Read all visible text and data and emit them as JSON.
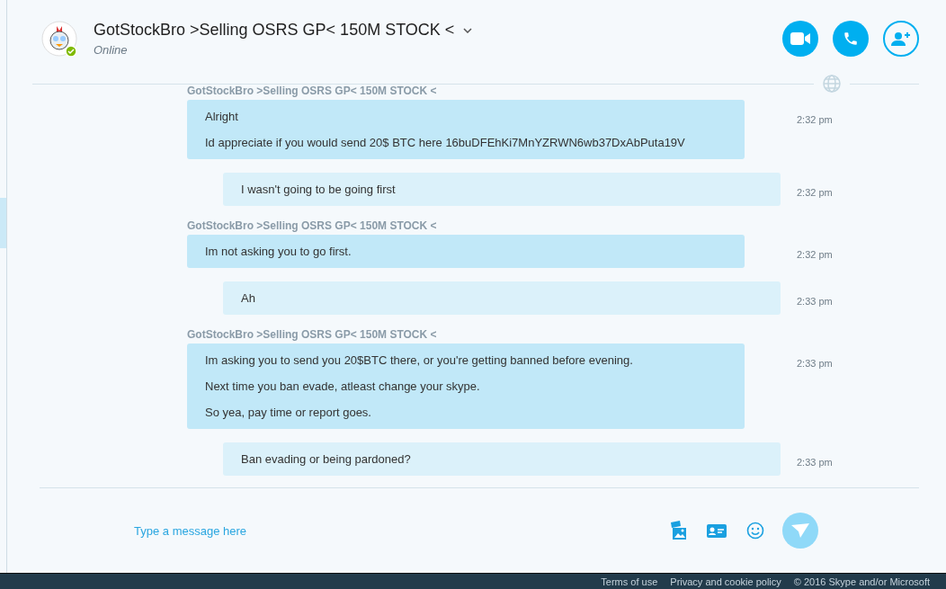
{
  "header": {
    "name": "GotStockBro >Selling OSRS GP< 150M STOCK <",
    "status": "Online",
    "online": true
  },
  "messages": [
    {
      "kind": "incoming",
      "sender": "GotStockBro >Selling OSRS GP< 150M STOCK <",
      "lines": [
        "Alright",
        "Id appreciate if you would send 20$ BTC here 16buDFEhKi7MnYZRWN6wb37DxAbPuta19V"
      ],
      "time": "2:32 pm"
    },
    {
      "kind": "outgoing",
      "lines": [
        "I wasn't going to be going first"
      ],
      "time": "2:32 pm"
    },
    {
      "kind": "incoming",
      "sender": "GotStockBro >Selling OSRS GP< 150M STOCK <",
      "lines": [
        "Im not asking you to go first."
      ],
      "time": "2:32 pm"
    },
    {
      "kind": "outgoing",
      "lines": [
        "Ah"
      ],
      "time": "2:33 pm"
    },
    {
      "kind": "incoming",
      "sender": "GotStockBro >Selling OSRS GP< 150M STOCK <",
      "lines": [
        "Im asking you to send you 20$BTC there, or you're getting banned before evening.",
        "Next time you ban evade, atleast change your skype.",
        "So yea, pay time or report goes."
      ],
      "time": "2:33 pm"
    },
    {
      "kind": "outgoing",
      "lines": [
        "Ban evading or being pardoned?"
      ],
      "time": "2:33 pm"
    }
  ],
  "composer": {
    "placeholder": "Type a message here"
  },
  "footer": {
    "links": [
      "Terms of use",
      "Privacy and cookie policy",
      "© 2016 Skype and/or Microsoft"
    ]
  }
}
